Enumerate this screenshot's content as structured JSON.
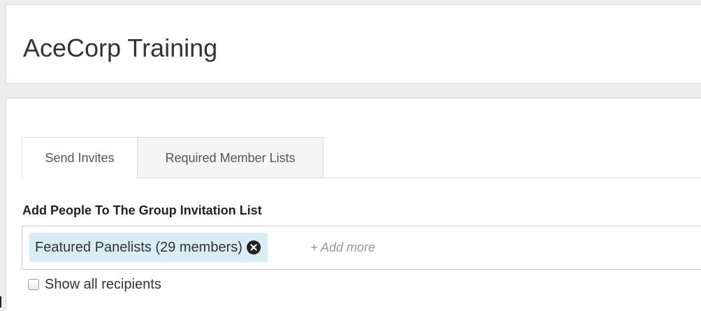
{
  "header": {
    "title": "AceCorp Training"
  },
  "tabs": [
    {
      "label": "Send Invites",
      "active": true
    },
    {
      "label": "Required Member Lists",
      "active": false
    }
  ],
  "invite_section": {
    "label": "Add People To The Group Invitation List",
    "tokens": [
      {
        "label": "Featured Panelists (29 members)",
        "remove_icon": "x-circle-icon"
      }
    ],
    "add_more_placeholder": "+ Add more",
    "show_all": {
      "label": "Show all recipients",
      "checked": false
    }
  },
  "colors": {
    "token_background": "#d9edf7",
    "page_background": "#ededed",
    "panel_background": "#ffffff"
  }
}
